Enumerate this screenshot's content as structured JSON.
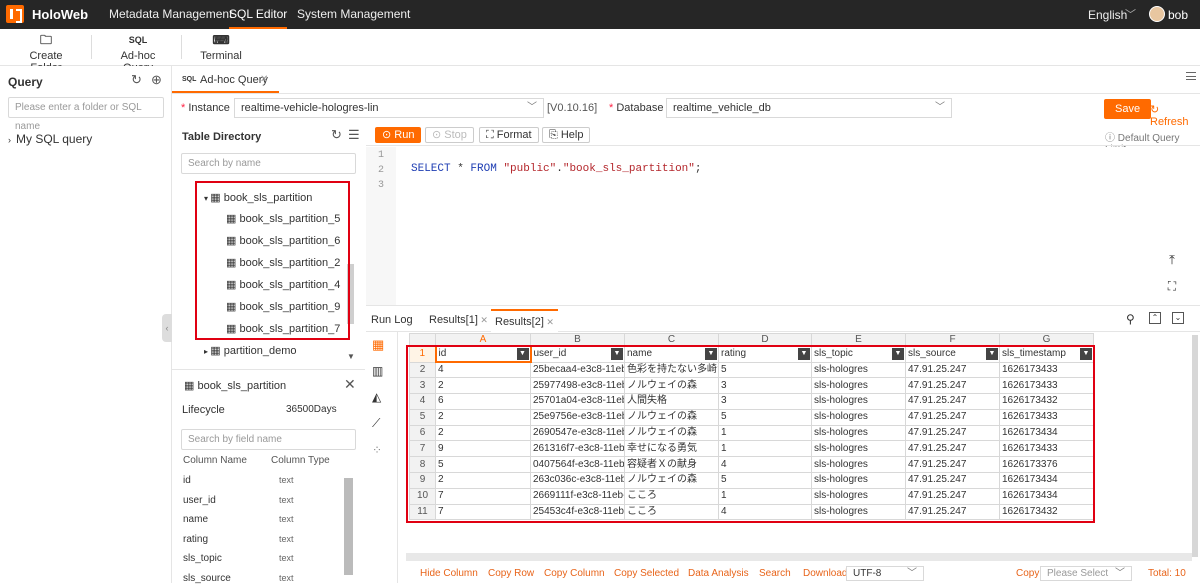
{
  "app": {
    "brand": "HoloWeb",
    "nav": [
      "Metadata Management",
      "SQL Editor",
      "System Management"
    ],
    "language": "English",
    "user": "bob"
  },
  "toolbar": {
    "create_folder": "Create Folder",
    "adhoc_icon": "SQL",
    "adhoc": "Ad-hoc Query",
    "terminal": "Terminal"
  },
  "query_panel": {
    "title": "Query",
    "search_placeholder": "Please enter a folder or SQL name",
    "tree_item": "My SQL query"
  },
  "tab": {
    "icon": "SQL",
    "label": "Ad-hoc Query"
  },
  "instance": {
    "label": "Instance",
    "value": "realtime-vehicle-hologres-lin",
    "version": "[V0.10.16]"
  },
  "database": {
    "label": "Database",
    "value": "realtime_vehicle_db"
  },
  "actions": {
    "save": "Save",
    "refresh": "Refresh",
    "run": "Run",
    "stop": "Stop",
    "format": "Format",
    "help": "Help",
    "limit": "Default Query Limit"
  },
  "table_dir": {
    "title": "Table Directory",
    "search_placeholder": "Search by name",
    "parent": "book_sls_partition",
    "children": [
      "book_sls_partition_5",
      "book_sls_partition_6",
      "book_sls_partition_2",
      "book_sls_partition_4",
      "book_sls_partition_9",
      "book_sls_partition_7"
    ],
    "sibling": "partition_demo"
  },
  "table_detail": {
    "name": "book_sls_partition",
    "lifecycle_label": "Lifecycle",
    "lifecycle_value": "36500Days",
    "field_placeholder": "Search by field name",
    "col_name_header": "Column Name",
    "col_type_header": "Column Type",
    "columns": [
      {
        "name": "id",
        "type": "text"
      },
      {
        "name": "user_id",
        "type": "text"
      },
      {
        "name": "name",
        "type": "text"
      },
      {
        "name": "rating",
        "type": "text"
      },
      {
        "name": "sls_topic",
        "type": "text"
      },
      {
        "name": "sls_source",
        "type": "text"
      }
    ]
  },
  "editor": {
    "lines": [
      "1",
      "2",
      "3"
    ],
    "sql_select": "SELECT",
    "sql_star": " * ",
    "sql_from": "FROM",
    "sql_schema": "\"public\"",
    "sql_dot": ".",
    "sql_table": "\"book_sls_partition\"",
    "sql_end": ";"
  },
  "results": {
    "tabs": [
      "Run Log",
      "Results[1]",
      "Results[2]"
    ],
    "col_letters": [
      "A",
      "B",
      "C",
      "D",
      "E",
      "F",
      "G"
    ],
    "headers": [
      "id",
      "user_id",
      "name",
      "rating",
      "sls_topic",
      "sls_source",
      "sls_timestamp"
    ],
    "row_numbers": [
      "1",
      "2",
      "3",
      "4",
      "5",
      "6",
      "7",
      "8",
      "9",
      "10",
      "11"
    ],
    "rows": [
      [
        "4",
        "25becaa4-e3c8-11eb-9",
        "色彩を持たない多崎つ",
        "5",
        "sls-hologres",
        "47.91.25.247",
        "1626173433"
      ],
      [
        "2",
        "25977498-e3c8-11eb-9",
        "ノルウェイの森",
        "3",
        "sls-hologres",
        "47.91.25.247",
        "1626173433"
      ],
      [
        "6",
        "25701a04-e3c8-11eb-a",
        "人間失格",
        "3",
        "sls-hologres",
        "47.91.25.247",
        "1626173432"
      ],
      [
        "2",
        "25e9756e-e3c8-11eb-a",
        "ノルウェイの森",
        "5",
        "sls-hologres",
        "47.91.25.247",
        "1626173433"
      ],
      [
        "2",
        "2690547e-e3c8-11eb-a",
        "ノルウェイの森",
        "1",
        "sls-hologres",
        "47.91.25.247",
        "1626173434"
      ],
      [
        "9",
        "261316f7-e3c8-11eb-b",
        "幸せになる勇気",
        "1",
        "sls-hologres",
        "47.91.25.247",
        "1626173433"
      ],
      [
        "5",
        "0407564f-e3c8-11eb-8",
        "容疑者Ｘの献身",
        "4",
        "sls-hologres",
        "47.91.25.247",
        "1626173376"
      ],
      [
        "2",
        "263c036c-e3c8-11eb-a",
        "ノルウェイの森",
        "5",
        "sls-hologres",
        "47.91.25.247",
        "1626173434"
      ],
      [
        "7",
        "2669111f-e3c8-11eb-a",
        "こころ",
        "1",
        "sls-hologres",
        "47.91.25.247",
        "1626173434"
      ],
      [
        "7",
        "25453c4f-e3c8-11eb-a",
        "こころ",
        "4",
        "sls-hologres",
        "47.91.25.247",
        "1626173432"
      ]
    ]
  },
  "footer": {
    "actions": [
      "Hide Column",
      "Copy Row",
      "Copy Column",
      "Copy Selected",
      "Data Analysis",
      "Search",
      "Download"
    ],
    "encoding": "UTF-8",
    "copy": "Copy",
    "copy_placeholder": "Please Select",
    "total": "Total: 10"
  },
  "colors": {
    "accent": "#ff6a00",
    "topbar": "#262626",
    "highlight_box": "#e00012"
  }
}
